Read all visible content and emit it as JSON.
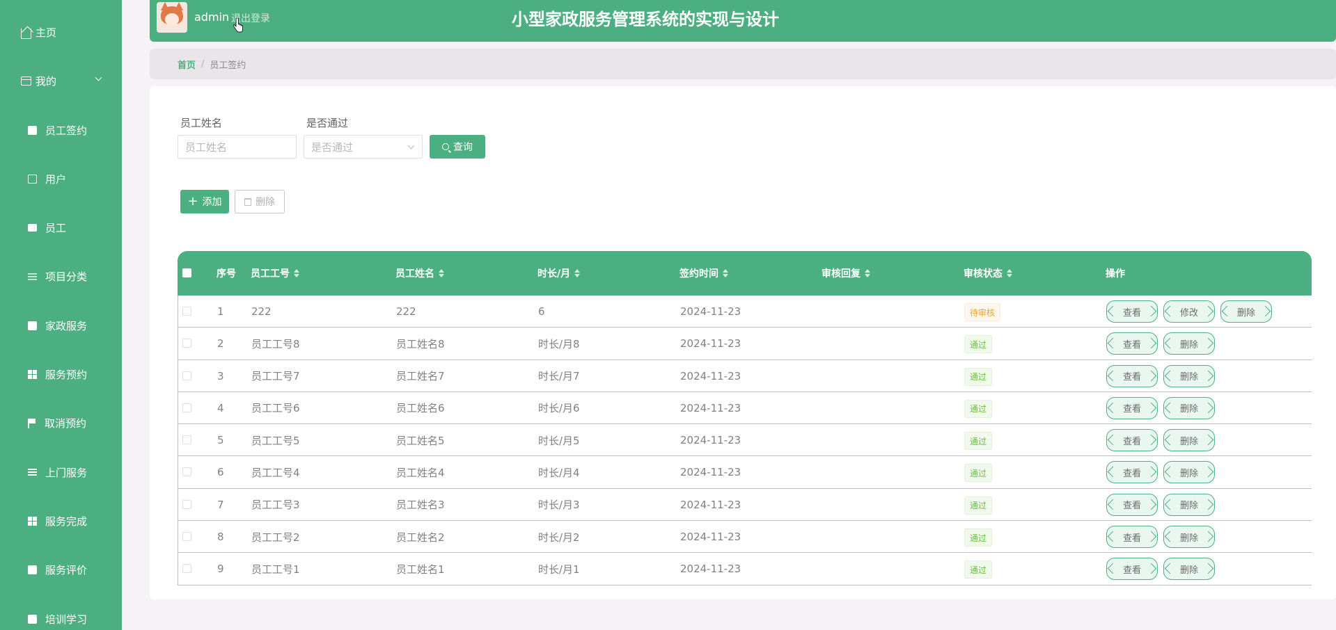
{
  "app": {
    "title": "小型家政服务管理系统的实现与设计",
    "username": "admin",
    "logout_label": "退出登录"
  },
  "sidebar": {
    "home": "主页",
    "mine": "我的",
    "items": [
      {
        "label": "员工签约",
        "icon": "clipboard-icon"
      },
      {
        "label": "用户",
        "icon": "chart-icon"
      },
      {
        "label": "员工",
        "icon": "chat-icon"
      },
      {
        "label": "项目分类",
        "icon": "sliders-icon"
      },
      {
        "label": "家政服务",
        "icon": "document-icon"
      },
      {
        "label": "服务预约",
        "icon": "grid-icon"
      },
      {
        "label": "取消预约",
        "icon": "flag-icon"
      },
      {
        "label": "上门服务",
        "icon": "list-icon"
      },
      {
        "label": "服务完成",
        "icon": "grid-icon"
      },
      {
        "label": "服务评价",
        "icon": "comment-icon"
      },
      {
        "label": "培训学习",
        "icon": "reading-icon"
      }
    ]
  },
  "breadcrumb": {
    "home": "首页",
    "separator": "/",
    "current": "员工签约"
  },
  "search": {
    "name_label": "员工姓名",
    "name_placeholder": "员工姓名",
    "pass_label": "是否通过",
    "pass_placeholder": "是否通过",
    "query_button": "查询"
  },
  "toolbar": {
    "add_label": "添加",
    "delete_label": "删除"
  },
  "table": {
    "headers": {
      "index": "序号",
      "emp_no": "员工工号",
      "emp_name": "员工姓名",
      "duration": "时长/月",
      "sign_time": "签约时间",
      "review_reply": "审核回复",
      "review_status": "审核状态",
      "actions": "操作"
    },
    "action_labels": {
      "view": "查看",
      "edit": "修改",
      "delete": "删除"
    },
    "rows": [
      {
        "index": "1",
        "emp_no": "222",
        "emp_name": "222",
        "duration": "6",
        "sign_time": "2024-11-23",
        "reply": "",
        "status": "待审核"
      },
      {
        "index": "2",
        "emp_no": "员工工号8",
        "emp_name": "员工姓名8",
        "duration": "时长/月8",
        "sign_time": "2024-11-23",
        "reply": "",
        "status": "通过"
      },
      {
        "index": "3",
        "emp_no": "员工工号7",
        "emp_name": "员工姓名7",
        "duration": "时长/月7",
        "sign_time": "2024-11-23",
        "reply": "",
        "status": "通过"
      },
      {
        "index": "4",
        "emp_no": "员工工号6",
        "emp_name": "员工姓名6",
        "duration": "时长/月6",
        "sign_time": "2024-11-23",
        "reply": "",
        "status": "通过"
      },
      {
        "index": "5",
        "emp_no": "员工工号5",
        "emp_name": "员工姓名5",
        "duration": "时长/月5",
        "sign_time": "2024-11-23",
        "reply": "",
        "status": "通过"
      },
      {
        "index": "6",
        "emp_no": "员工工号4",
        "emp_name": "员工姓名4",
        "duration": "时长/月4",
        "sign_time": "2024-11-23",
        "reply": "",
        "status": "通过"
      },
      {
        "index": "7",
        "emp_no": "员工工号3",
        "emp_name": "员工姓名3",
        "duration": "时长/月3",
        "sign_time": "2024-11-23",
        "reply": "",
        "status": "通过"
      },
      {
        "index": "8",
        "emp_no": "员工工号2",
        "emp_name": "员工姓名2",
        "duration": "时长/月2",
        "sign_time": "2024-11-23",
        "reply": "",
        "status": "通过"
      },
      {
        "index": "9",
        "emp_no": "员工工号1",
        "emp_name": "员工姓名1",
        "duration": "时长/月1",
        "sign_time": "2024-11-23",
        "reply": "",
        "status": "通过"
      }
    ]
  },
  "colors": {
    "primary": "#4caf81",
    "pending": "#e6a23c",
    "pass": "#67c23a"
  }
}
